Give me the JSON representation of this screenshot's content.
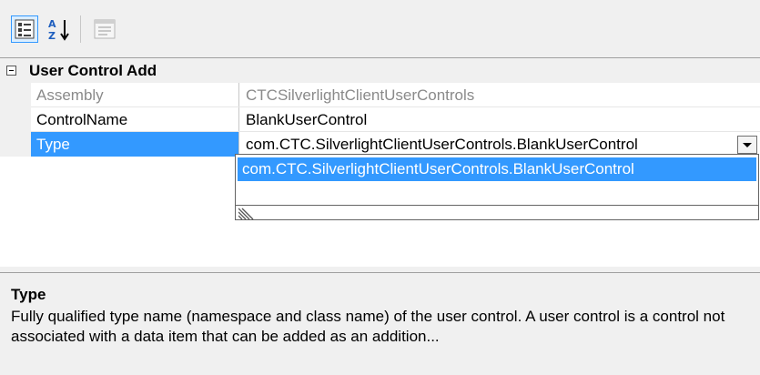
{
  "toolbar": {
    "buttons": [
      {
        "name": "categorized-icon",
        "active": true
      },
      {
        "name": "alphabetical-sort-icon",
        "active": false
      },
      {
        "name": "property-pages-icon",
        "active": false,
        "disabled": true
      }
    ]
  },
  "grid": {
    "category": {
      "label": "User Control Add",
      "expanded": true
    },
    "rows": [
      {
        "name": "Assembly",
        "value": "CTCSilverlightClientUserControls",
        "readonly": true
      },
      {
        "name": "ControlName",
        "value": "BlankUserControl",
        "readonly": false
      },
      {
        "name": "Type",
        "value": "com.CTC.SilverlightClientUserControls.BlankUserControl",
        "selected": true
      }
    ],
    "dropdown": {
      "options": [
        "com.CTC.SilverlightClientUserControls.BlankUserControl"
      ]
    }
  },
  "description": {
    "title": "Type",
    "text": "Fully qualified type name (namespace and class name) of the user control. A user control is a control not associated with a data item that can be added as an addition..."
  },
  "colors": {
    "selection": "#3399ff",
    "border": "#a0a0a0",
    "background": "#f0f0f0"
  }
}
